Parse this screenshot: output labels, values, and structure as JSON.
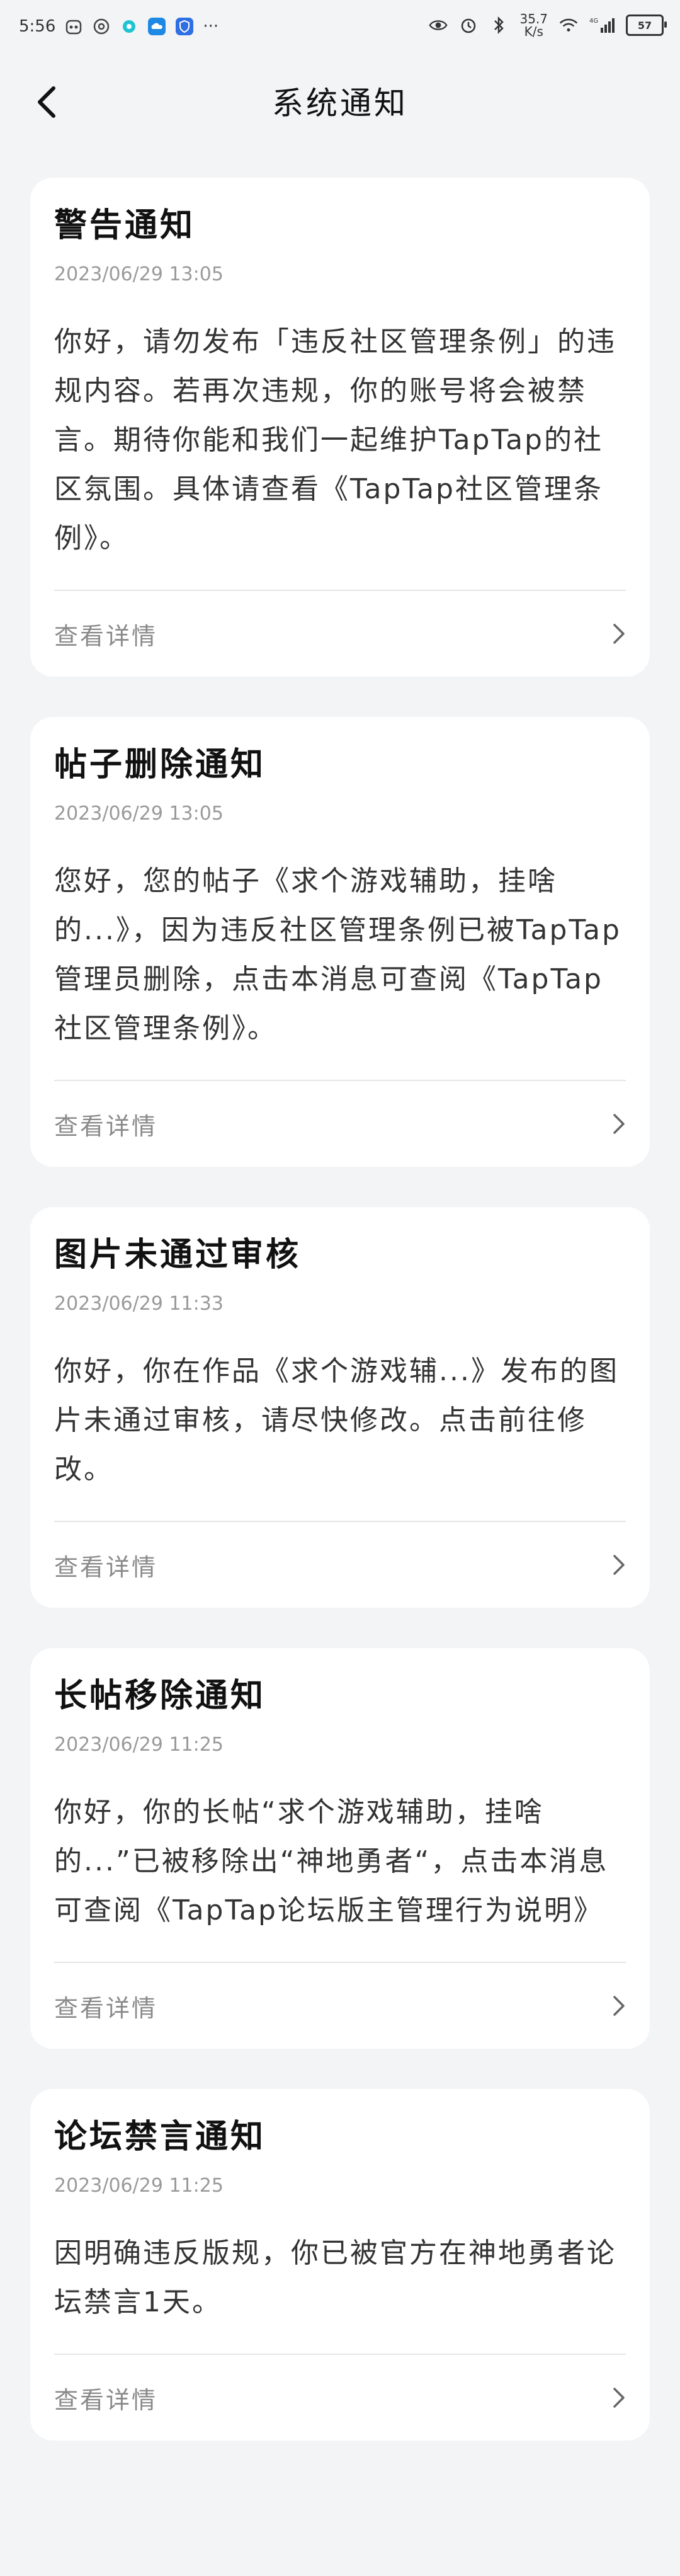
{
  "status_bar": {
    "time": "5:56",
    "more": "···",
    "net_speed_value": "35.7",
    "net_speed_unit": "K/s",
    "signal_label": "4G",
    "battery_level": "57",
    "icons": [
      "eye-icon",
      "alarm-icon",
      "bluetooth-icon",
      "wifi-icon",
      "signal-icon",
      "battery-icon"
    ]
  },
  "header": {
    "title": "系统通知",
    "back_icon": "chevron-left-icon"
  },
  "cards": [
    {
      "title": "警告通知",
      "time": "2023/06/29 13:05",
      "body": "你好，请勿发布「违反社区管理条例」的违规内容。若再次违规，你的账号将会被禁言。期待你能和我们一起维护TapTap的社区氛围。具体请查看《TapTap社区管理条例》。",
      "action": "查看详情"
    },
    {
      "title": "帖子删除通知",
      "time": "2023/06/29 13:05",
      "body": "您好，您的帖子《求个游戏辅助，挂啥的...》，因为违反社区管理条例已被TapTap管理员删除，点击本消息可查阅《TapTap社区管理条例》。",
      "action": "查看详情"
    },
    {
      "title": "图片未通过审核",
      "time": "2023/06/29 11:33",
      "body": "你好，你在作品《求个游戏辅...》发布的图片未通过审核，请尽快修改。点击前往修改。",
      "action": "查看详情"
    },
    {
      "title": "长帖移除通知",
      "time": "2023/06/29 11:25",
      "body": "你好，你的长帖“求个游戏辅助，挂啥的...”已被移除出“神地勇者“，点击本消息可查阅《TapTap论坛版主管理行为说明》",
      "action": "查看详情"
    },
    {
      "title": "论坛禁言通知",
      "time": "2023/06/29 11:25",
      "body": "因明确违反版规，你已被官方在神地勇者论坛禁言1天。",
      "action": "查看详情"
    }
  ]
}
